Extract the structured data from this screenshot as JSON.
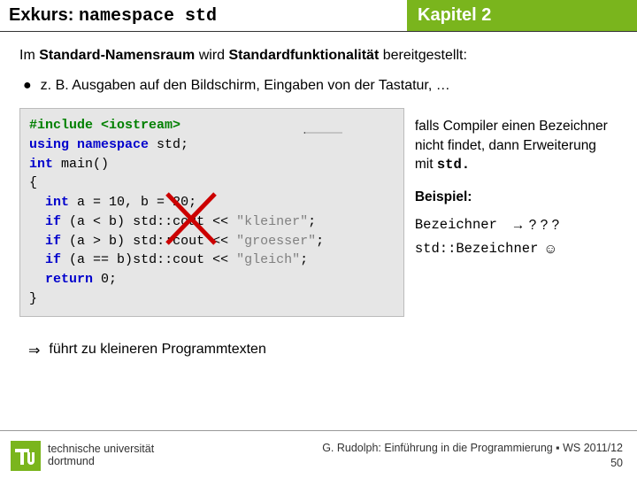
{
  "header": {
    "left_label": "Exkurs:",
    "left_code": "namespace std",
    "right": "Kapitel 2"
  },
  "intro": {
    "pre": "Im ",
    "b1": "Standard-Namensraum",
    "mid": " wird ",
    "b2": "Standardfunktionalität",
    "post": " bereitgestellt:"
  },
  "bullet": {
    "dot": "●",
    "text": "z. B. Ausgaben auf den Bildschirm, Eingaben von der Tastatur, …"
  },
  "code": {
    "l1a": "#include",
    "l1b": "<iostream>",
    "l2a": "using namespace",
    "l2b": "std;",
    "l3a": "int",
    "l3b": "main()",
    "l4": "{",
    "l5a": "int",
    "l5b": "a = 10, b = 20;",
    "l6a": "if",
    "l6b": "(a < b) ",
    "l6c": "std::",
    "l6d": "cout << ",
    "l6e": "\"kleiner\"",
    "l6f": ";",
    "l7a": "if",
    "l7b": "(a > b) ",
    "l7c": "std::",
    "l7d": "cout << ",
    "l7e": "\"groesser\"",
    "l7f": ";",
    "l8a": "if",
    "l8b": "(a == b)",
    "l8c": "std::",
    "l8d": "cout << ",
    "l8e": "\"gleich\"",
    "l8f": ";",
    "l9a": "return",
    "l9b": "0;",
    "l10": "}"
  },
  "side": {
    "p1": "falls Compiler einen Bezeichner nicht findet, dann Erweiterung mit",
    "p1_code": "std.",
    "heading": "Beispiel:",
    "row1a": "Bezeichner",
    "row1b": "→ ? ? ?",
    "row2a": "std::Bezeichner",
    "row2b": "☺"
  },
  "conclusion": {
    "arrow": "⇒",
    "text": "führt zu kleineren Programmtexten"
  },
  "footer": {
    "uni1": "technische universität",
    "uni2": "dortmund",
    "right1": "G. Rudolph: Einführung in die Programmierung ▪ WS 2011/12",
    "right2": "50"
  }
}
